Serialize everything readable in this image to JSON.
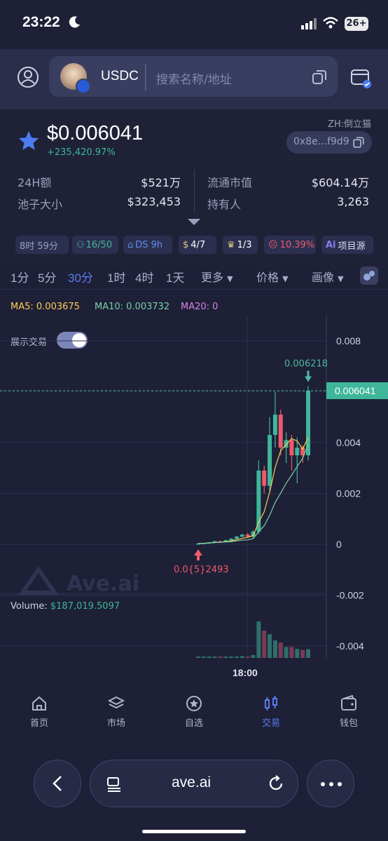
{
  "status": {
    "time": "23:22",
    "battery": "26+"
  },
  "search": {
    "token": "USDC",
    "placeholder": "搜索名称/地址"
  },
  "token": {
    "price": "$0.006041",
    "change": "+235,420.97%",
    "alias": "ZH:倒立猫",
    "address": "0x8e...f9d9"
  },
  "metrics": [
    {
      "label": "24H额",
      "value": "$521万"
    },
    {
      "label": "流通市值",
      "value": "$604.14万"
    },
    {
      "label": "池子大小",
      "value": "$323,453"
    },
    {
      "label": "持有人",
      "value": "3,263"
    }
  ],
  "chips": [
    {
      "text": "8时 59分"
    },
    {
      "text": "16/50"
    },
    {
      "text": "DS 9h"
    },
    {
      "text": "4/7"
    },
    {
      "text": "1/3"
    },
    {
      "text": "10.39%"
    },
    {
      "text": "项目源"
    }
  ],
  "timeframes": [
    "1分",
    "5分",
    "30分",
    "1时",
    "4时",
    "1天"
  ],
  "dropdowns": [
    "更多",
    "价格",
    "画像"
  ],
  "indicators": {
    "ma5": "MA5: 0.003675",
    "ma10": "MA10: 0.003732",
    "ma20": "MA20: 0"
  },
  "toggle": {
    "label": "展示交易"
  },
  "chart_data": {
    "type": "candlestick",
    "y_ticks": [
      "0.008",
      "0.006041",
      "0.004",
      "0.002",
      "0",
      "-0.002",
      "-0.004"
    ],
    "ylim": [
      -0.004,
      0.008
    ],
    "last_price": "0.006041",
    "high_label": "0.006218",
    "low_label": "0.0{5}2493",
    "x_label": "18:00",
    "volume_label": "Volume:",
    "volume_value": "$187,019.5097",
    "watermark": "Ave.ai",
    "candles": [
      {
        "o": 1e-05,
        "c": 3e-05,
        "h": 4e-05,
        "l": 0.0
      },
      {
        "o": 3e-05,
        "c": 5e-05,
        "h": 6e-05,
        "l": 2e-05
      },
      {
        "o": 5e-05,
        "c": 8e-05,
        "h": 9e-05,
        "l": 4e-05
      },
      {
        "o": 8e-05,
        "c": 0.00012,
        "h": 0.00014,
        "l": 7e-05
      },
      {
        "o": 0.00012,
        "c": 0.0001,
        "h": 0.00015,
        "l": 9e-05
      },
      {
        "o": 0.0001,
        "c": 0.00016,
        "h": 0.00018,
        "l": 9e-05
      },
      {
        "o": 0.00016,
        "c": 0.00022,
        "h": 0.00024,
        "l": 0.00015
      },
      {
        "o": 0.00022,
        "c": 0.0003,
        "h": 0.00033,
        "l": 0.0002
      },
      {
        "o": 0.0003,
        "c": 0.00038,
        "h": 0.00042,
        "l": 0.00028
      },
      {
        "o": 0.00038,
        "c": 0.0003,
        "h": 0.00045,
        "l": 0.00025
      },
      {
        "o": 0.0003,
        "c": 0.0005,
        "h": 0.00055,
        "l": 0.00025
      },
      {
        "o": 0.0005,
        "c": 0.0029,
        "h": 0.0033,
        "l": 0.0004
      },
      {
        "o": 0.0029,
        "c": 0.0023,
        "h": 0.0031,
        "l": 0.002
      },
      {
        "o": 0.0023,
        "c": 0.0043,
        "h": 0.005,
        "l": 0.0021
      },
      {
        "o": 0.0043,
        "c": 0.0051,
        "h": 0.006,
        "l": 0.0038
      },
      {
        "o": 0.0051,
        "c": 0.0038,
        "h": 0.0053,
        "l": 0.0035
      },
      {
        "o": 0.0038,
        "c": 0.0041,
        "h": 0.0044,
        "l": 0.0032
      },
      {
        "o": 0.0041,
        "c": 0.0035,
        "h": 0.0043,
        "l": 0.0029
      },
      {
        "o": 0.0035,
        "c": 0.0038,
        "h": 0.0042,
        "l": 0.0024
      },
      {
        "o": 0.0038,
        "c": 0.0035,
        "h": 0.0039,
        "l": 0.0032
      },
      {
        "o": 0.0035,
        "c": 0.00604,
        "h": 0.00622,
        "l": 0.0033
      }
    ],
    "volumes": [
      0.01,
      0.015,
      0.02,
      0.03,
      0.025,
      0.03,
      0.035,
      0.04,
      0.05,
      0.04,
      0.08,
      1.0,
      0.75,
      0.65,
      0.48,
      0.42,
      0.3,
      0.3,
      0.25,
      0.22,
      0.24
    ]
  },
  "nav": [
    {
      "label": "首页",
      "icon": "home-icon"
    },
    {
      "label": "市场",
      "icon": "layers-icon"
    },
    {
      "label": "自选",
      "icon": "favorite-icon"
    },
    {
      "label": "交易",
      "icon": "candle-icon"
    },
    {
      "label": "钱包",
      "icon": "wallet-icon"
    }
  ],
  "browser": {
    "url": "ave.ai"
  },
  "colors": {
    "up": "#3fb69a",
    "down": "#ef5a6b",
    "accent": "#5b7cf0",
    "ma5": "#ffce55",
    "ma10": "#7ad0a8",
    "ma20": "#d884e8"
  }
}
